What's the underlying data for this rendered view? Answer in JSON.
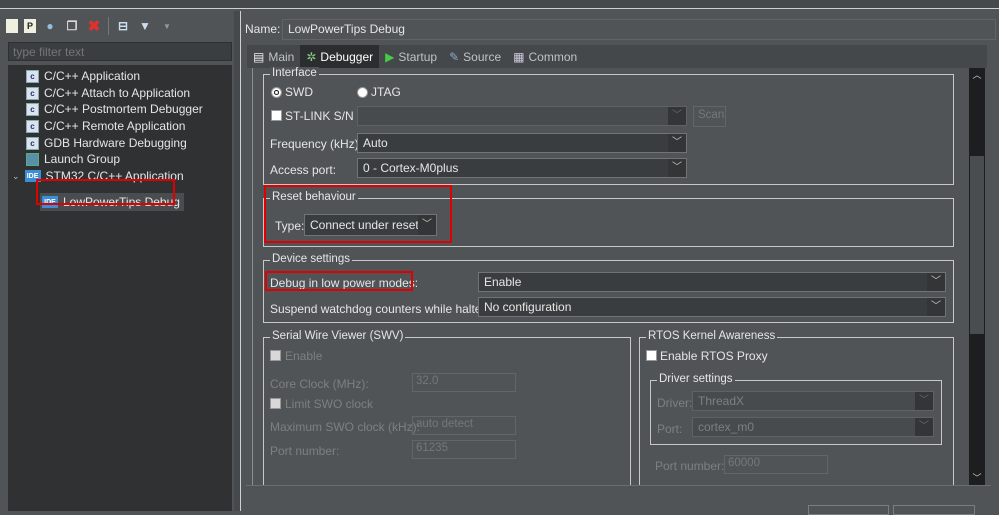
{
  "left_panel": {
    "toolbar": [
      {
        "icon": "new-configuration-icon"
      },
      {
        "icon": "new-prototype-icon"
      },
      {
        "icon": "export-icon"
      },
      {
        "icon": "duplicate-icon"
      },
      {
        "icon": "delete-icon"
      },
      {
        "icon": "collapse-all-icon"
      },
      {
        "icon": "filter-icon"
      },
      {
        "icon": "menu-dropdown-icon"
      }
    ],
    "filter_placeholder": "type filter text",
    "tree": [
      {
        "label": "C/C++ Application",
        "icon": "c-icon"
      },
      {
        "label": "C/C++ Attach to Application",
        "icon": "c-icon"
      },
      {
        "label": "C/C++ Postmortem Debugger",
        "icon": "c-icon"
      },
      {
        "label": "C/C++ Remote Application",
        "icon": "c-icon"
      },
      {
        "label": "GDB Hardware Debugging",
        "icon": "c-icon"
      },
      {
        "label": "Launch Group",
        "icon": "launch-group-icon"
      },
      {
        "label": "STM32 C/C++ Application",
        "icon": "ide-icon",
        "expanded": true
      },
      {
        "label": "LowPowerTips Debug",
        "icon": "ide-icon",
        "selected": true,
        "ide_text": "IDE"
      }
    ]
  },
  "name": {
    "label": "Name:",
    "value": "LowPowerTips Debug"
  },
  "tabs": [
    {
      "label": "Main",
      "icon": "document-icon"
    },
    {
      "label": "Debugger",
      "icon": "bug-icon",
      "active": true
    },
    {
      "label": "Startup",
      "icon": "play-icon"
    },
    {
      "label": "Source",
      "icon": "source-icon"
    },
    {
      "label": "Common",
      "icon": "common-icon"
    }
  ],
  "interface": {
    "title": "Interface",
    "swd": "SWD",
    "jtag": "JTAG",
    "selected": "SWD",
    "stlink_label": "ST-LINK S/N",
    "stlink_value": "",
    "scan": "Scan",
    "frequency_label": "Frequency (kHz):",
    "frequency_value": "Auto",
    "access_port_label": "Access port:",
    "access_port_value": "0 - Cortex-M0plus"
  },
  "reset": {
    "title": "Reset behaviour",
    "type_label": "Type:",
    "type_value": "Connect under reset"
  },
  "device": {
    "title": "Device settings",
    "low_power_label": "Debug in low power modes:",
    "low_power_value": "Enable",
    "watchdog_label": "Suspend watchdog counters while halted:",
    "watchdog_value": "No configuration"
  },
  "swv": {
    "title": "Serial Wire Viewer (SWV)",
    "enable": "Enable",
    "core_clock_label": "Core Clock (MHz):",
    "core_clock_value": "32.0",
    "limit_swo": "Limit SWO clock",
    "max_swo_label": "Maximum SWO clock (kHz):",
    "max_swo_value": "auto detect",
    "port_label": "Port number:",
    "port_value": "61235"
  },
  "rtos": {
    "title": "RTOS Kernel Awareness",
    "enable_proxy": "Enable RTOS Proxy",
    "driver_settings": "Driver settings",
    "driver_label": "Driver:",
    "driver_value": "ThreadX",
    "port_label": "Port:",
    "port_value": "cortex_m0",
    "port_number_label": "Port number:",
    "port_number_value": "60000"
  },
  "colors": {
    "highlight": "#e00000",
    "background": "#505456",
    "tree_bg": "#2f3133"
  }
}
